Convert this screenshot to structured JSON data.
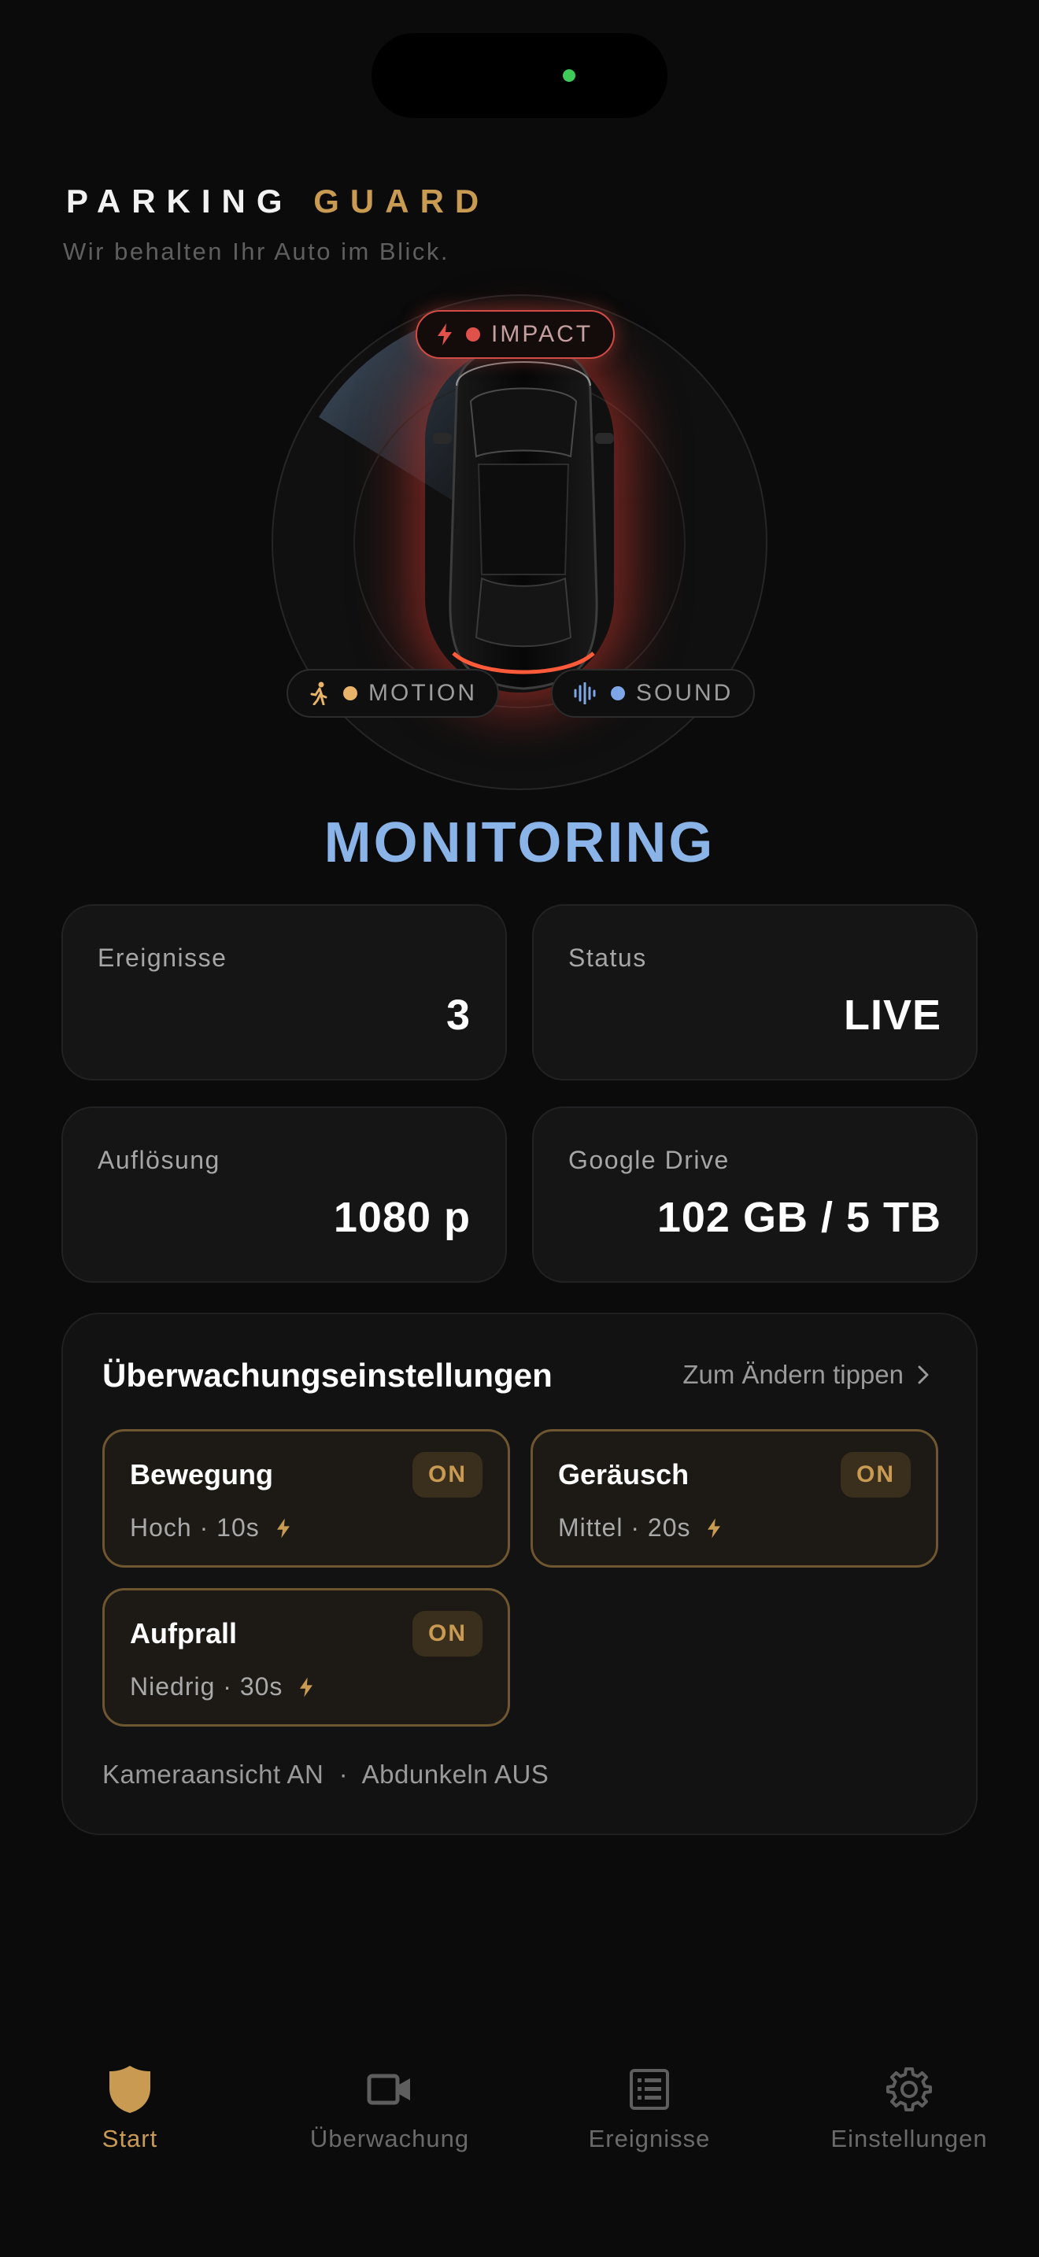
{
  "header": {
    "brand_primary": "PARKING",
    "brand_accent": "GUARD",
    "tagline": "Wir behalten Ihr Auto im Blick."
  },
  "sensors": {
    "impact": {
      "label": "IMPACT",
      "icon": "bolt-icon",
      "color": "#e0514a"
    },
    "motion": {
      "label": "MOTION",
      "icon": "walking-icon",
      "color": "#e8b46a"
    },
    "sound": {
      "label": "SOUND",
      "icon": "soundwave-icon",
      "color": "#7ea6e6"
    }
  },
  "status_title": "MONITORING",
  "stats": [
    {
      "label": "Ereignisse",
      "value": "3"
    },
    {
      "label": "Status",
      "value": "LIVE"
    },
    {
      "label": "Auflösung",
      "value": "1080 p"
    },
    {
      "label": "Google Drive",
      "value": "102 GB / 5 TB"
    }
  ],
  "settings": {
    "title": "Überwachungseinstellungen",
    "hint": "Zum Ändern tippen",
    "tiles": [
      {
        "name": "Bewegung",
        "state": "ON",
        "detail": "Hoch · 10s"
      },
      {
        "name": "Geräusch",
        "state": "ON",
        "detail": "Mittel · 20s"
      },
      {
        "name": "Aufprall",
        "state": "ON",
        "detail": "Niedrig · 30s"
      }
    ],
    "footer": "Kameraansicht AN  ·  Abdunkeln AUS"
  },
  "nav": [
    {
      "label": "Start",
      "icon": "shield-icon",
      "active": true
    },
    {
      "label": "Überwachung",
      "icon": "video-camera-icon",
      "active": false
    },
    {
      "label": "Ereignisse",
      "icon": "list-icon",
      "active": false
    },
    {
      "label": "Einstellungen",
      "icon": "gear-icon",
      "active": false
    }
  ],
  "colors": {
    "accent": "#c89a52",
    "monitoring": "#8ab3e8",
    "background": "#0b0b0b"
  }
}
